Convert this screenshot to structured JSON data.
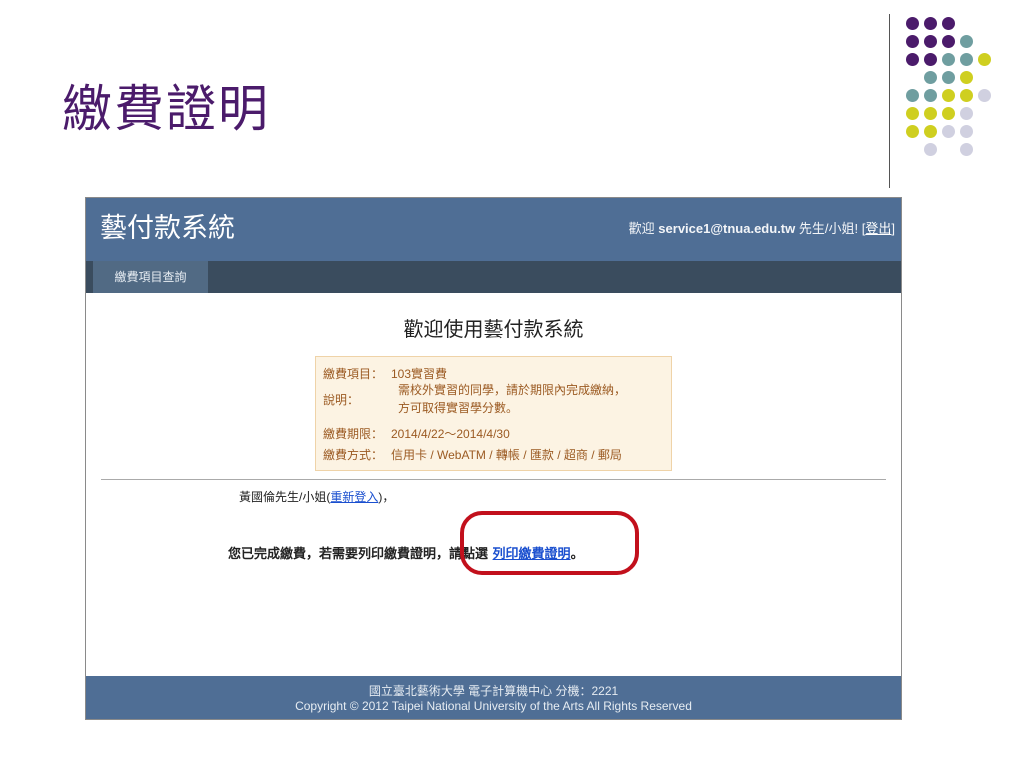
{
  "slide": {
    "title": "繳費證明",
    "dot_colors": {
      "purple": "#4b1b6b",
      "teal": "#6f9ea0",
      "yellow": "#cfcf20",
      "lavender": "#d0d0e0"
    }
  },
  "app": {
    "title": "藝付款系統",
    "header": {
      "welcome_prefix": "歡迎",
      "user_email": "service1@tnua.edu.tw",
      "honorific": "先生/小姐!",
      "bracket_open": "[",
      "logout_link": "登出",
      "bracket_close": "]"
    },
    "nav": {
      "tab_payment_query": "繳費項目查詢"
    },
    "main": {
      "heading": "歡迎使用藝付款系統",
      "info": {
        "item_label": "繳費項目：",
        "item_value": "103實習費",
        "desc_label": "說明：",
        "desc_line1": "需校外實習的同學，請於期限內完成繳納，",
        "desc_line2": "方可取得實習學分數。",
        "period_label": "繳費期限：",
        "period_value": "2014/4/22～2014/4/30",
        "method_label": "繳費方式：",
        "method_value": "信用卡 / WebATM / 轉帳 / 匯款 / 超商 / 郵局"
      },
      "user_name": "黃國倫先生/小姐(",
      "relogin_link": "重新登入",
      "user_suffix": ")，",
      "done_message": "您已完成繳費，若需要列印繳費證明，請點選",
      "print_link": "列印繳費證明",
      "done_suffix": "。"
    },
    "footer": {
      "line1": "國立臺北藝術大學 電子計算機中心 分機：2221",
      "line2": "Copyright © 2012 Taipei National University of the Arts All Rights Reserved"
    },
    "colors": {
      "header": "#4f6e95",
      "nav": "#3a4c5e",
      "highlight": "#c2101c",
      "link": "#1a4fcf"
    }
  }
}
